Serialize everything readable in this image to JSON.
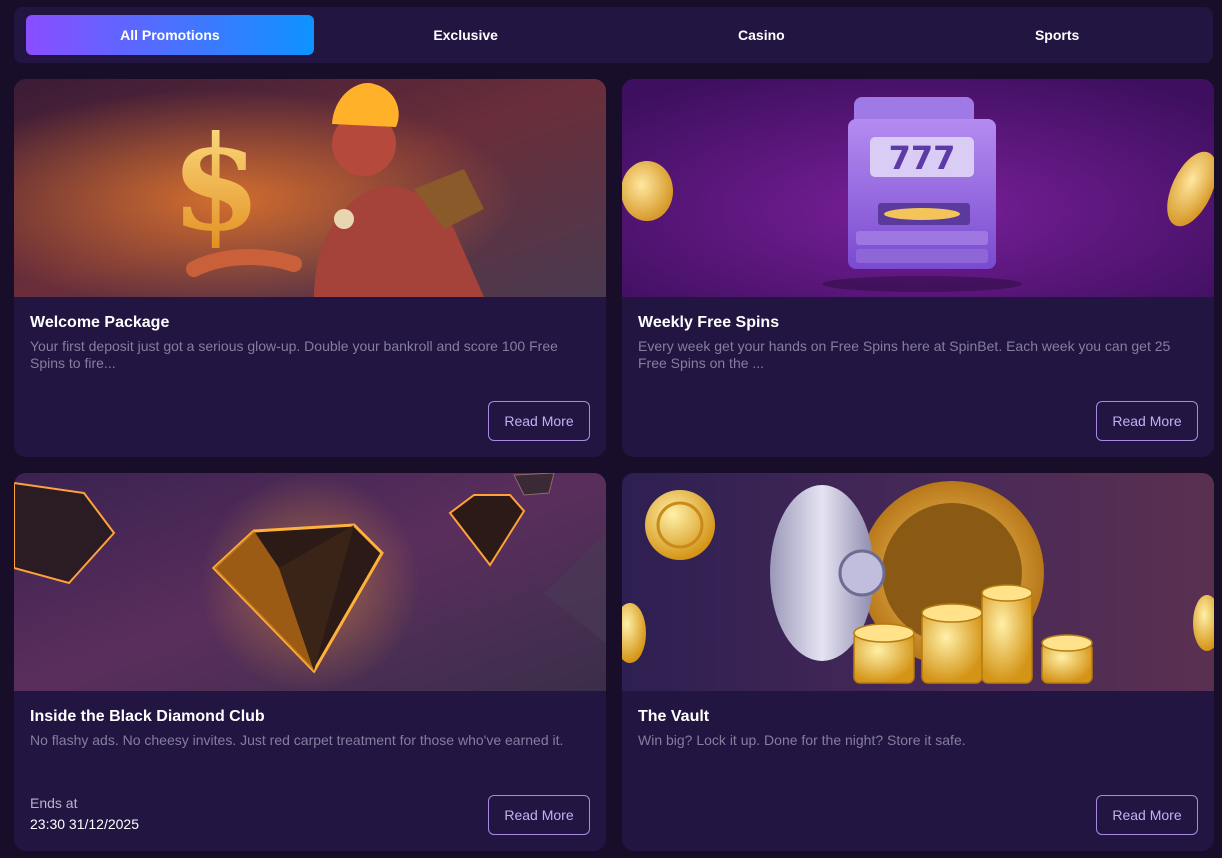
{
  "tabs": [
    {
      "label": "All Promotions",
      "active": true
    },
    {
      "label": "Exclusive",
      "active": false
    },
    {
      "label": "Casino",
      "active": false
    },
    {
      "label": "Sports",
      "active": false
    }
  ],
  "cards": [
    {
      "title": "Welcome Package",
      "description": "Your first deposit just got a serious glow-up. Double your bankroll and score 100 Free Spins to fire...",
      "button": "Read More",
      "banner_icon": "fire-demon-dollar-illustration"
    },
    {
      "title": "Weekly Free Spins",
      "description": "Every week get your hands on Free Spins here at SpinBet. Each week you can get 25 Free Spins on the ...",
      "button": "Read More",
      "banner_icon": "slot-machine-illustration",
      "slot_text": "777"
    },
    {
      "title": "Inside the Black Diamond Club",
      "description": "No flashy ads. No cheesy invites. Just red carpet treatment for those who've earned it.",
      "button": "Read More",
      "banner_icon": "black-diamond-illustration",
      "ends_label": "Ends at",
      "ends_value": "23:30 31/12/2025"
    },
    {
      "title": "The Vault",
      "description": "Win big? Lock it up. Done for the night? Store it safe.",
      "button": "Read More",
      "banner_icon": "vault-coins-illustration"
    }
  ],
  "colors": {
    "page_bg": "#190e2a",
    "card_bg": "#221541",
    "tab_active_start": "#8a4dff",
    "tab_active_end": "#0e93ff",
    "button_border": "#a78ae0"
  }
}
